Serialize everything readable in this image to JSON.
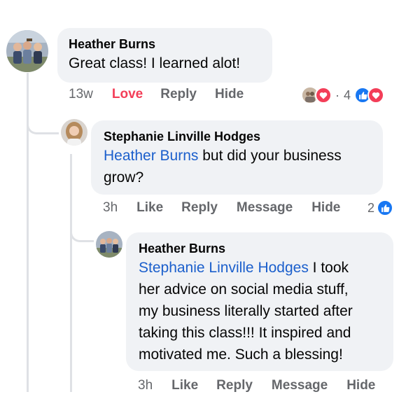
{
  "comments": [
    {
      "author": "Heather Burns",
      "text": "Great class! I learned alot!",
      "time": "13w",
      "actions": {
        "love": "Love",
        "reply": "Reply",
        "hide": "Hide"
      },
      "reaction_count": "4",
      "reaction_separator": "·",
      "reaction_icons": [
        "photo-avatar-reaction",
        "heart-reaction",
        "like-reaction",
        "heart-reaction"
      ]
    },
    {
      "author": "Stephanie Linville Hodges",
      "mention": "Heather Burns",
      "text_line1": " but did your business",
      "text_line2": "grow?",
      "time": "3h",
      "actions": {
        "like": "Like",
        "reply": "Reply",
        "message": "Message",
        "hide": "Hide"
      },
      "reaction_count": "2",
      "reaction_icons": [
        "like-reaction"
      ]
    },
    {
      "author": "Heather Burns",
      "mention": "Stephanie Linville Hodges",
      "text_lines": [
        " I took",
        "her advice on social media stuff,",
        "my business literally started after",
        "taking this class!!! It inspired and",
        "motivated me. Such a blessing!"
      ],
      "time": "3h",
      "actions": {
        "like": "Like",
        "reply": "Reply",
        "message": "Message",
        "hide": "Hide"
      }
    }
  ],
  "colors": {
    "bubble": "#f0f2f5",
    "mention": "#1b5fcc",
    "action_text": "#65676b",
    "love": "#f33e58",
    "like_blue": "#1877f2",
    "thread_line": "#dfe1e5"
  }
}
